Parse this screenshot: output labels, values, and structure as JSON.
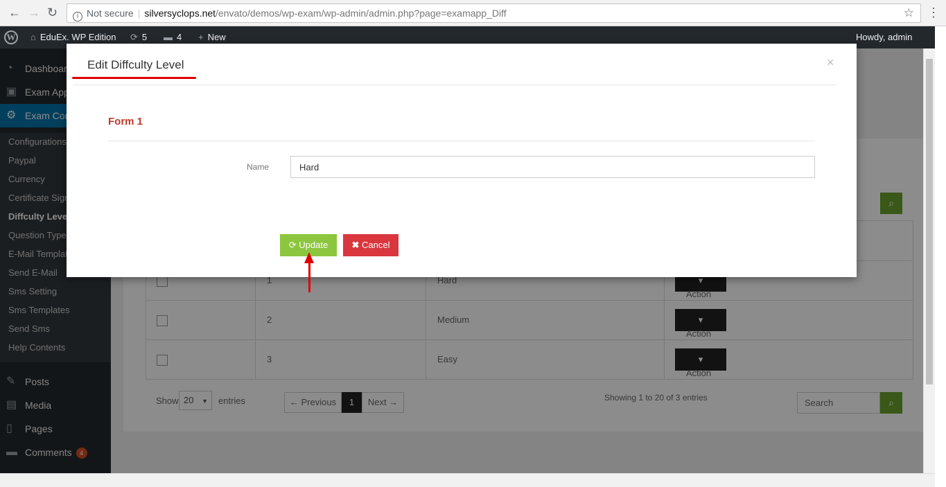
{
  "browser": {
    "security_label": "Not secure",
    "url_host": "silversyclops.net",
    "url_path": "/envato/demos/wp-exam/wp-admin/admin.php?page=examapp_Diff"
  },
  "adminbar": {
    "site_name": "EduEx. WP Edition",
    "updates_count": "5",
    "comments_count": "4",
    "new_label": "New",
    "greeting": "Howdy, admin"
  },
  "sidebar": {
    "top_items": [
      {
        "label": "Dashboard"
      },
      {
        "label": "Exam App"
      },
      {
        "label": "Exam Con"
      }
    ],
    "sub_items": [
      {
        "label": "Configurations"
      },
      {
        "label": "Paypal"
      },
      {
        "label": "Currency"
      },
      {
        "label": "Certificate Sign"
      },
      {
        "label": "Diffculty Level"
      },
      {
        "label": "Question Type"
      },
      {
        "label": "E-Mail Templat"
      },
      {
        "label": "Send E-Mail"
      },
      {
        "label": "Sms Setting"
      },
      {
        "label": "Sms Templates"
      },
      {
        "label": "Send Sms"
      },
      {
        "label": "Help Contents"
      }
    ],
    "bottom_items": [
      {
        "label": "Posts"
      },
      {
        "label": "Media"
      },
      {
        "label": "Pages"
      },
      {
        "label": "Comments",
        "badge": "4"
      }
    ]
  },
  "table": {
    "rows": [
      {
        "id": "1",
        "name": "Hard",
        "action": "Action"
      },
      {
        "id": "2",
        "name": "Medium",
        "action": "Action"
      },
      {
        "id": "3",
        "name": "Easy",
        "action": "Action"
      }
    ],
    "show_label": "Show",
    "entries_value": "20",
    "entries_label": "entries",
    "prev_label": "← Previous",
    "page": "1",
    "next_label": "Next →",
    "info": "Showing 1 to 20 of 3 entries",
    "search_placeholder": "Search"
  },
  "modal": {
    "title": "Edit Diffculty Level",
    "form_title": "Form 1",
    "name_label": "Name",
    "name_value": "Hard",
    "update_label": "Update",
    "cancel_label": "Cancel",
    "close_glyph": "×"
  }
}
